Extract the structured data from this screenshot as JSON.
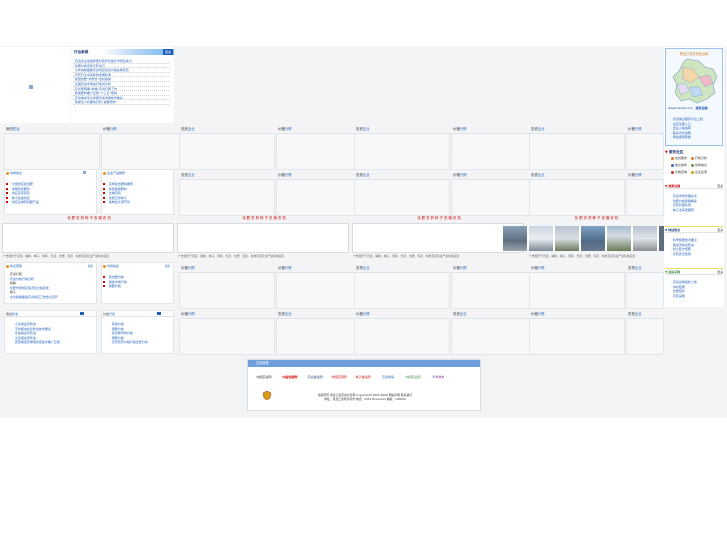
{
  "news": {
    "title": "行业新闻",
    "more": "更多",
    "items": [
      "· 农资企业加快转型升级步伐提升市场竞争力",
      "· 化肥价格走势平稳运行",
      "· 今年春耕备耕农资供应充足价格总体稳定",
      "· 农药行业迎来新的发展机遇",
      "· 我国化肥“零增长”目标提前",
      "· 全国农资市场运行情况分析",
      "· 农业部部署“春季”农资打假工作",
      "· 新型肥料推广应用“十三五”规划",
      "· 农资电商平台发展迅速市场前景看好",
      "· 植保无人机推动农药“减量增效”"
    ]
  },
  "region_map": {
    "title": "黑龙江省农资信息网",
    "url": "www.hljnzw.com",
    "links": [
      "农资企业",
      "服务指南"
    ],
    "notice": [
      "· 农资信息服务平台上线",
      "· 会员注册入口",
      "· 企业入驻指南",
      "· 联系方式说明",
      "· 网站使用帮助"
    ]
  },
  "service": {
    "title": "服务社区",
    "items": [
      [
        "在线服务",
        "行情分析"
      ],
      [
        "信息发布",
        "供求信息"
      ],
      [
        "价格查询",
        "企业名录"
      ]
    ]
  },
  "side_sections": [
    {
      "title": "政策法规",
      "more": "更多",
      "items": [
        "· 农资市场管理办法",
        "· 化肥价格政策解读",
        "· 农药管理条例",
        "· 种子法实施细则"
      ]
    },
    {
      "title": "科技知识",
      "more": "更多",
      "items": [
        "· 科学施肥技术要点",
        "· 病虫害综合防治",
        "· 测土配方施肥",
        "· 农药安全使用"
      ]
    },
    {
      "title": "招标采购",
      "more": "更多",
      "items": [
        "· 农资采购招标公告",
        "· 中标结果",
        "· 化肥招标",
        "· 农药采购"
      ]
    }
  ],
  "grid_row1": [
    {
      "a": "病虫",
      "b": "防治"
    },
    {
      "a": "价格",
      "b": "行情"
    },
    {
      "a": "农资",
      "b": "企业"
    },
    {
      "a": "价格",
      "b": "行情"
    },
    {
      "a": "农资",
      "b": "企业"
    },
    {
      "a": "价格",
      "b": "行情"
    },
    {
      "a": "农资",
      "b": "企业"
    },
    {
      "a": "价格",
      "b": "行情"
    }
  ],
  "feature_boxes": [
    {
      "title": "供求信息",
      "items": [
        "· 大量供应复合肥",
        "· 求购有机肥料",
        "· 供应农药原药",
        "· 种子批发供应",
        "· 供应生物有机肥产品"
      ]
    },
    {
      "title": "企业产品推荐",
      "items": [
        "· 高效复合肥料推荐",
        "· 新型缓释肥料",
        "· 生物农药",
        "· 优质玉米种子",
        "· 植物生长调节剂"
      ]
    }
  ],
  "grid_row2": [
    {
      "a": "农资",
      "b": "企业"
    },
    {
      "a": "价格",
      "b": "行情"
    },
    {
      "a": "农资",
      "b": "企业"
    },
    {
      "a": "价格",
      "b": "行情"
    },
    {
      "a": "农资",
      "b": "企业"
    },
    {
      "a": "价格",
      "b": "行情"
    }
  ],
  "strip_text": "化 肥 农 药 种 子 农 膜 农 机",
  "ad_text": "广告服务于农资、播种、种子、饲料、兽药、化肥、农药、各类农资及生产资料供应商",
  "feature2": [
    {
      "title": "热点聚焦",
      "more": "更多",
      "items": [
        "· 农资打假",
        "· 农资价格行情分析",
        "· 春耕",
        "· 化肥市场供应情况及价格走势",
        "· 种子",
        "· 全省春耕备耕农资供应工作会议召开"
      ]
    },
    {
      "title": "市场动态",
      "more": "更多",
      "items": [
        "· 复合肥价格",
        "· 尿素市场行情",
        "· 磷肥价格"
      ]
    }
  ],
  "grid_row3": [
    {
      "a": "价格",
      "b": "行情"
    },
    {
      "a": "价格",
      "b": "行情"
    },
    {
      "a": "农资",
      "b": "企业"
    },
    {
      "a": "价格",
      "b": "行情"
    },
    {
      "a": "价格",
      "b": "行情"
    },
    {
      "a": "农资",
      "b": "企业"
    }
  ],
  "bottom_lists": [
    {
      "title": "病虫",
      "b": "防治",
      "items": [
        "· 小麦病虫害防治",
        "· 玉米螟虫综合防治技术要点",
        "· 水稻病虫害防治",
        "· 大豆病虫害防治",
        "· 蔬菜病虫害绿色防控技术推广应用"
      ]
    },
    {
      "title": "价格",
      "b": "行情",
      "items": [
        "· 尿素价格",
        "· 磷肥价格",
        "· 复合肥市场价格",
        "· 钾肥价格",
        "· 农药原药价格行情走势分析"
      ]
    }
  ],
  "grid_row4": [
    {
      "a": "价格",
      "b": "行情"
    },
    {
      "a": "农资",
      "b": "企业"
    },
    {
      "a": "价格",
      "b": "行情"
    },
    {
      "a": "农资",
      "b": "企业"
    },
    {
      "a": "价格",
      "b": "行情"
    },
    {
      "a": "农资",
      "b": "企业"
    }
  ],
  "links_bar": "友情链接",
  "partner_logos": [
    "中国农资网",
    "中国化肥网",
    "农业信息网",
    "中国农药网",
    "种子信息网",
    "农资商情",
    "中国农业网",
    "农资导报"
  ],
  "footer": {
    "line1": "版权所有 黑龙江省农资信息网 Copyright©2005-2008 网站声明 联系我们",
    "line2": "地址：黑龙江省哈尔滨市 电话：0451-8xxxxxxx 邮编：150000"
  },
  "colors": {
    "accent": "#1f5fb8",
    "header_bar": "#6f9fdc",
    "red": "#cc0000",
    "band": "#f3f4f6"
  }
}
